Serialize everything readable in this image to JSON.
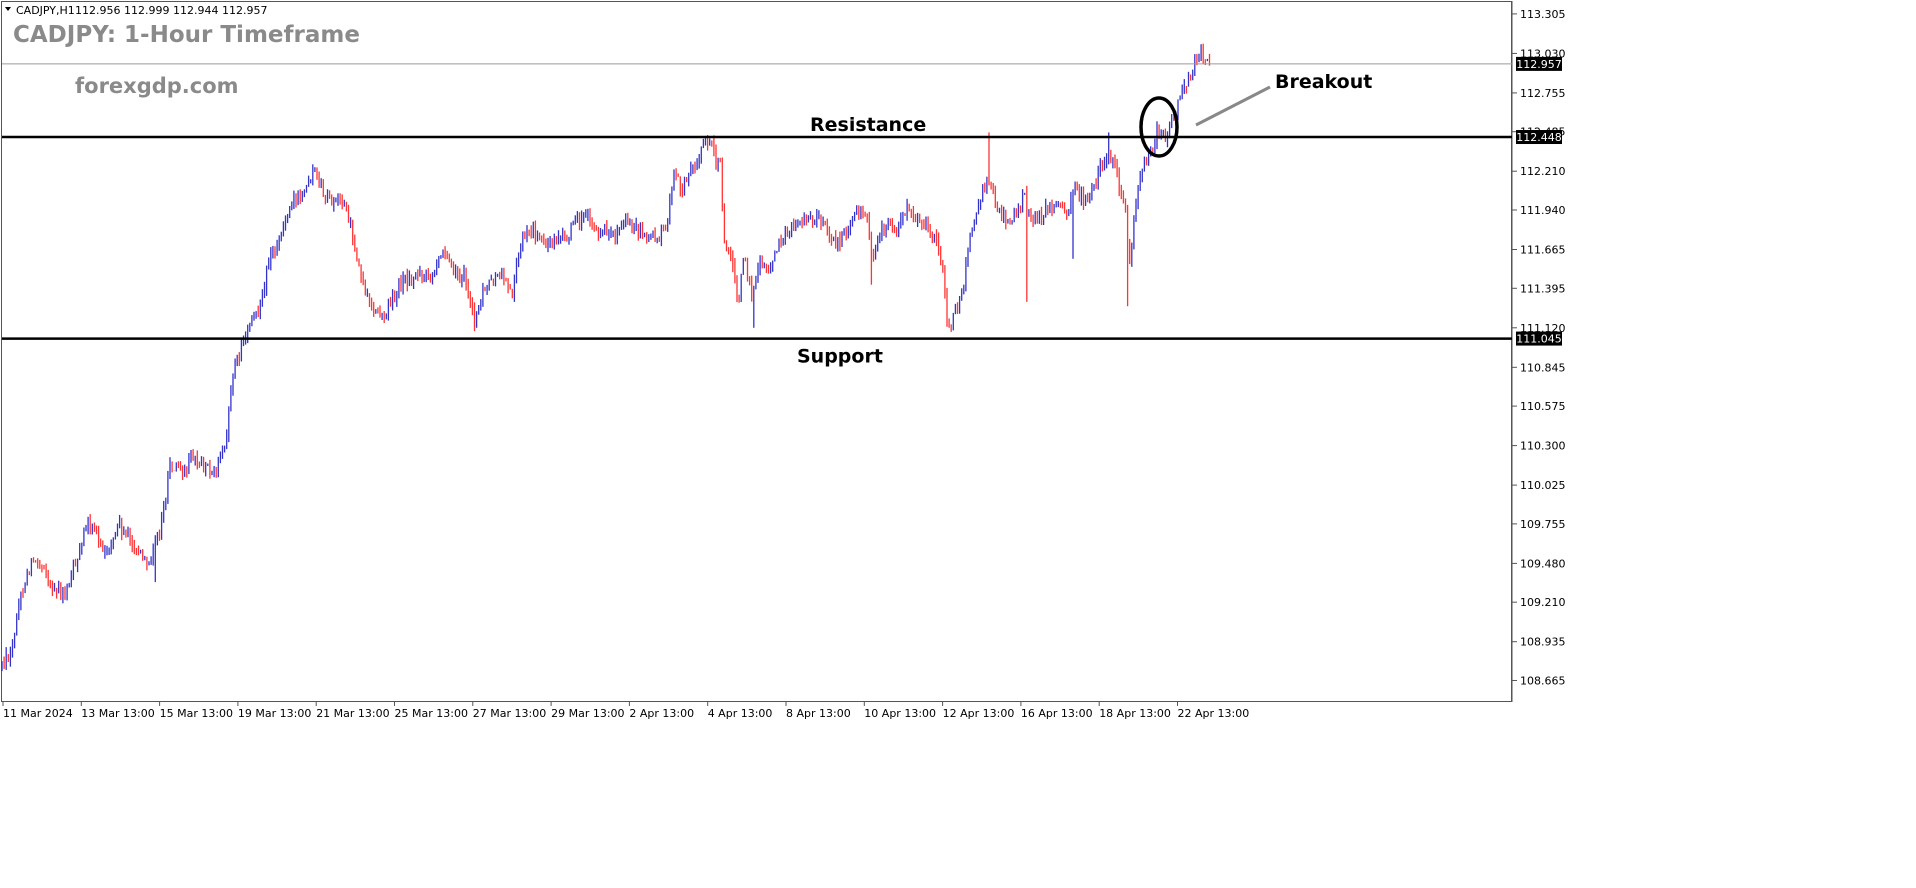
{
  "header": {
    "symbol_info": "CADJPY,H1",
    "ohlc": "112.956 112.999 112.944 112.957"
  },
  "overlay": {
    "title": "CADJPY: 1-Hour Timeframe",
    "watermark": "forexgdp.com",
    "breakout_label": "Breakout",
    "resistance_label": "Resistance",
    "support_label": "Support"
  },
  "chart_data": {
    "type": "candlestick",
    "symbol": "CADJPY",
    "timeframe": "H1",
    "current_price": 112.957,
    "ylim": [
      108.55,
      113.36
    ],
    "y_ticks": [
      113.305,
      113.03,
      112.755,
      112.485,
      112.21,
      111.94,
      111.665,
      111.395,
      111.12,
      110.845,
      110.575,
      110.3,
      110.025,
      109.755,
      109.48,
      109.21,
      108.935,
      108.665
    ],
    "y_tick_labels": [
      "113.305",
      "113.030",
      "112.755",
      "112.485",
      "112.210",
      "111.940",
      "111.665",
      "111.395",
      "111.120",
      "110.845",
      "110.575",
      "110.300",
      "110.025",
      "109.755",
      "109.480",
      "109.210",
      "108.935",
      "108.665"
    ],
    "x_tick_labels": [
      "11 Mar 2024",
      "13 Mar 13:00",
      "15 Mar 13:00",
      "19 Mar 13:00",
      "21 Mar 13:00",
      "25 Mar 13:00",
      "27 Mar 13:00",
      "29 Mar 13:00",
      "2 Apr 13:00",
      "4 Apr 13:00",
      "8 Apr 13:00",
      "10 Apr 13:00",
      "12 Apr 13:00",
      "16 Apr 13:00",
      "18 Apr 13:00",
      "22 Apr 13:00"
    ],
    "levels": [
      {
        "name": "Resistance",
        "value": 112.448
      },
      {
        "name": "Support",
        "value": 111.045
      }
    ],
    "bull_color": "#3333cc",
    "bear_color": "#ff3333",
    "close_path": [
      [
        0,
        108.75
      ],
      [
        12,
        108.9
      ],
      [
        22,
        109.3
      ],
      [
        32,
        109.5
      ],
      [
        45,
        109.4
      ],
      [
        55,
        109.3
      ],
      [
        65,
        109.25
      ],
      [
        78,
        109.55
      ],
      [
        88,
        109.75
      ],
      [
        98,
        109.65
      ],
      [
        108,
        109.55
      ],
      [
        118,
        109.75
      ],
      [
        128,
        109.65
      ],
      [
        140,
        109.55
      ],
      [
        150,
        109.5
      ],
      [
        160,
        109.7
      ],
      [
        170,
        110.15
      ],
      [
        182,
        110.1
      ],
      [
        192,
        110.2
      ],
      [
        205,
        110.15
      ],
      [
        215,
        110.1
      ],
      [
        225,
        110.3
      ],
      [
        232,
        110.75
      ],
      [
        240,
        110.95
      ],
      [
        248,
        111.1
      ],
      [
        255,
        111.2
      ],
      [
        262,
        111.35
      ],
      [
        270,
        111.6
      ],
      [
        280,
        111.75
      ],
      [
        290,
        111.95
      ],
      [
        298,
        112.05
      ],
      [
        308,
        112.15
      ],
      [
        315,
        112.25
      ],
      [
        322,
        112.1
      ],
      [
        330,
        112.0
      ],
      [
        340,
        112.05
      ],
      [
        350,
        111.85
      ],
      [
        358,
        111.55
      ],
      [
        366,
        111.35
      ],
      [
        375,
        111.25
      ],
      [
        382,
        111.2
      ],
      [
        392,
        111.3
      ],
      [
        402,
        111.45
      ],
      [
        412,
        111.45
      ],
      [
        422,
        111.5
      ],
      [
        432,
        111.5
      ],
      [
        440,
        111.65
      ],
      [
        450,
        111.55
      ],
      [
        458,
        111.45
      ],
      [
        465,
        111.5
      ],
      [
        474,
        111.15
      ],
      [
        482,
        111.35
      ],
      [
        492,
        111.45
      ],
      [
        502,
        111.5
      ],
      [
        512,
        111.35
      ],
      [
        520,
        111.7
      ],
      [
        528,
        111.85
      ],
      [
        536,
        111.75
      ],
      [
        546,
        111.7
      ],
      [
        556,
        111.7
      ],
      [
        566,
        111.75
      ],
      [
        576,
        111.85
      ],
      [
        586,
        111.9
      ],
      [
        596,
        111.8
      ],
      [
        606,
        111.8
      ],
      [
        616,
        111.75
      ],
      [
        626,
        111.85
      ],
      [
        636,
        111.8
      ],
      [
        646,
        111.75
      ],
      [
        656,
        111.75
      ],
      [
        666,
        111.8
      ],
      [
        673,
        112.2
      ],
      [
        682,
        112.1
      ],
      [
        690,
        112.2
      ],
      [
        698,
        112.3
      ],
      [
        706,
        112.4
      ],
      [
        712,
        112.4
      ],
      [
        716,
        112.25
      ],
      [
        720,
        112.3
      ],
      [
        724,
        111.75
      ],
      [
        732,
        111.55
      ],
      [
        738,
        111.3
      ],
      [
        744,
        111.6
      ],
      [
        752,
        111.35
      ],
      [
        760,
        111.6
      ],
      [
        768,
        111.5
      ],
      [
        778,
        111.7
      ],
      [
        788,
        111.8
      ],
      [
        798,
        111.85
      ],
      [
        808,
        111.85
      ],
      [
        818,
        111.9
      ],
      [
        828,
        111.8
      ],
      [
        836,
        111.7
      ],
      [
        846,
        111.8
      ],
      [
        856,
        111.9
      ],
      [
        866,
        111.95
      ],
      [
        872,
        111.6
      ],
      [
        878,
        111.75
      ],
      [
        888,
        111.85
      ],
      [
        898,
        111.8
      ],
      [
        906,
        111.95
      ],
      [
        916,
        111.9
      ],
      [
        926,
        111.85
      ],
      [
        936,
        111.75
      ],
      [
        942,
        111.55
      ],
      [
        948,
        111.1
      ],
      [
        954,
        111.2
      ],
      [
        962,
        111.35
      ],
      [
        970,
        111.75
      ],
      [
        978,
        112.0
      ],
      [
        986,
        112.15
      ],
      [
        992,
        112.05
      ],
      [
        1000,
        111.95
      ],
      [
        1008,
        111.85
      ],
      [
        1016,
        111.9
      ],
      [
        1024,
        112.05
      ],
      [
        1032,
        111.85
      ],
      [
        1040,
        111.9
      ],
      [
        1048,
        111.95
      ],
      [
        1058,
        111.95
      ],
      [
        1066,
        111.9
      ],
      [
        1074,
        112.1
      ],
      [
        1084,
        112.0
      ],
      [
        1094,
        112.1
      ],
      [
        1104,
        112.3
      ],
      [
        1112,
        112.3
      ],
      [
        1120,
        112.1
      ],
      [
        1126,
        111.9
      ],
      [
        1130,
        111.55
      ],
      [
        1136,
        112.0
      ],
      [
        1144,
        112.3
      ],
      [
        1152,
        112.35
      ],
      [
        1158,
        112.5
      ],
      [
        1166,
        112.45
      ],
      [
        1174,
        112.6
      ],
      [
        1182,
        112.75
      ],
      [
        1188,
        112.85
      ],
      [
        1194,
        112.95
      ],
      [
        1200,
        113.05
      ],
      [
        1206,
        112.98
      ],
      [
        1210,
        112.957
      ]
    ],
    "spikes": [
      {
        "x": 1027,
        "low": 111.3
      },
      {
        "x": 1129,
        "low": 111.27
      },
      {
        "x": 871,
        "low": 111.42
      },
      {
        "x": 1073,
        "low": 111.6
      },
      {
        "x": 755,
        "low": 111.12
      },
      {
        "x": 155,
        "low": 109.35
      },
      {
        "x": 989,
        "high": 112.48
      },
      {
        "x": 1110,
        "high": 112.48
      }
    ]
  }
}
